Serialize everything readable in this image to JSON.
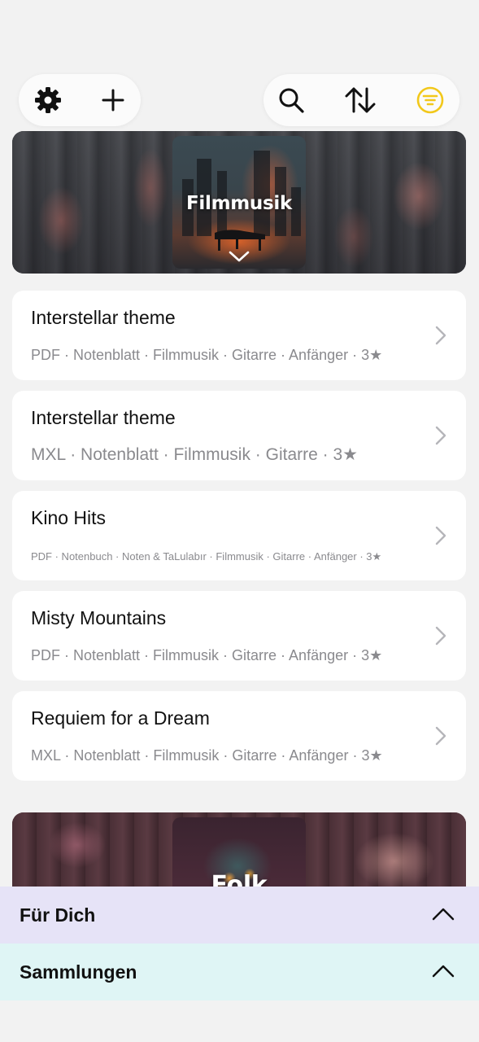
{
  "toolbar": {
    "left_icons": [
      "gear-icon",
      "plus-icon"
    ],
    "right_icons": [
      "search-icon",
      "sort-icon",
      "filter-icon"
    ],
    "accent_color": "#f2c81b"
  },
  "collections": [
    {
      "title": "Filmmusik"
    },
    {
      "title": "Folk"
    }
  ],
  "items": [
    {
      "title": "Interstellar theme",
      "meta": "PDF · Notenblatt · Filmmusik · Gitarre · Anfänger · 3★"
    },
    {
      "title": "Interstellar theme",
      "meta": "MXL · Notenblatt · Filmmusik · Gitarre · 3★"
    },
    {
      "title": "Kino Hits",
      "meta": "PDF · Notenbuch · Noten & TaLulabır · Filmmusik · Gitarre · Anfänger · 3★"
    },
    {
      "title": "Misty Mountains",
      "meta": "PDF · Notenblatt · Filmmusik · Gitarre · Anfänger · 3★"
    },
    {
      "title": "Requiem for a Dream",
      "meta": "MXL · Notenblatt · Filmmusik · Gitarre · Anfänger · 3★"
    }
  ],
  "panels": {
    "fuer_dich": {
      "label": "Für Dich",
      "color": "#e6e3f7"
    },
    "sammlungen": {
      "label": "Sammlungen",
      "color": "#dff5f5"
    }
  }
}
